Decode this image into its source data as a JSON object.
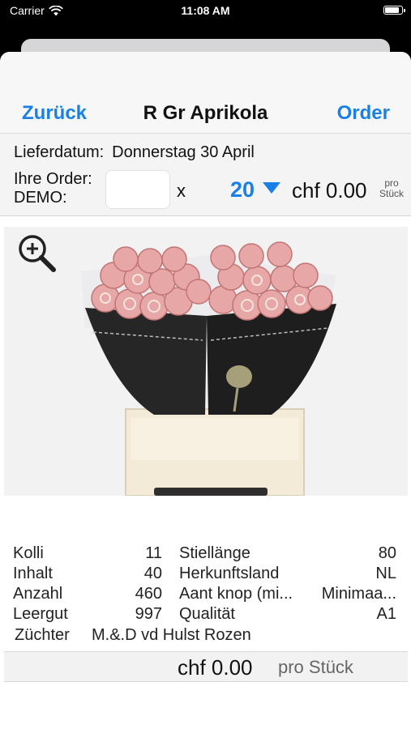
{
  "status_bar": {
    "carrier": "Carrier",
    "time": "11:08 AM"
  },
  "nav": {
    "back_label": "Zurück",
    "title": "R Gr Aprikola",
    "order_label": "Order"
  },
  "order": {
    "delivery_label": "Lieferdatum:",
    "delivery_date": "Donnerstag 30 April",
    "order_label_line1": "Ihre Order:",
    "order_label_line2": "DEMO:",
    "quantity_value": "",
    "times": "x",
    "unit_value": "20",
    "price": "chf 0.00",
    "per_line1": "pro",
    "per_line2": "Stück"
  },
  "details": {
    "left": [
      {
        "label": "Kolli",
        "value": "11"
      },
      {
        "label": "Inhalt",
        "value": "40"
      },
      {
        "label": "Anzahl",
        "value": "460"
      },
      {
        "label": "Leergut",
        "value": "997"
      }
    ],
    "right": [
      {
        "label": "Stiellänge",
        "value": "80"
      },
      {
        "label": "Herkunftsland",
        "value": "NL"
      },
      {
        "label": "Aant knop (mi...",
        "value": "Minimaa..."
      },
      {
        "label": "Qualität",
        "value": "A1"
      }
    ],
    "breeder_label": "Züchter",
    "breeder_value": "M.&.D vd Hulst Rozen"
  },
  "footer": {
    "price": "chf 0.00",
    "unit": "pro Stück"
  },
  "colors": {
    "accent": "#1a80e8",
    "background": "#f4f4f5"
  },
  "icons": {
    "zoom": "zoom-in-icon",
    "unit_picker": "caret-down-icon",
    "signal": "wifi-icon",
    "battery": "battery-icon"
  }
}
